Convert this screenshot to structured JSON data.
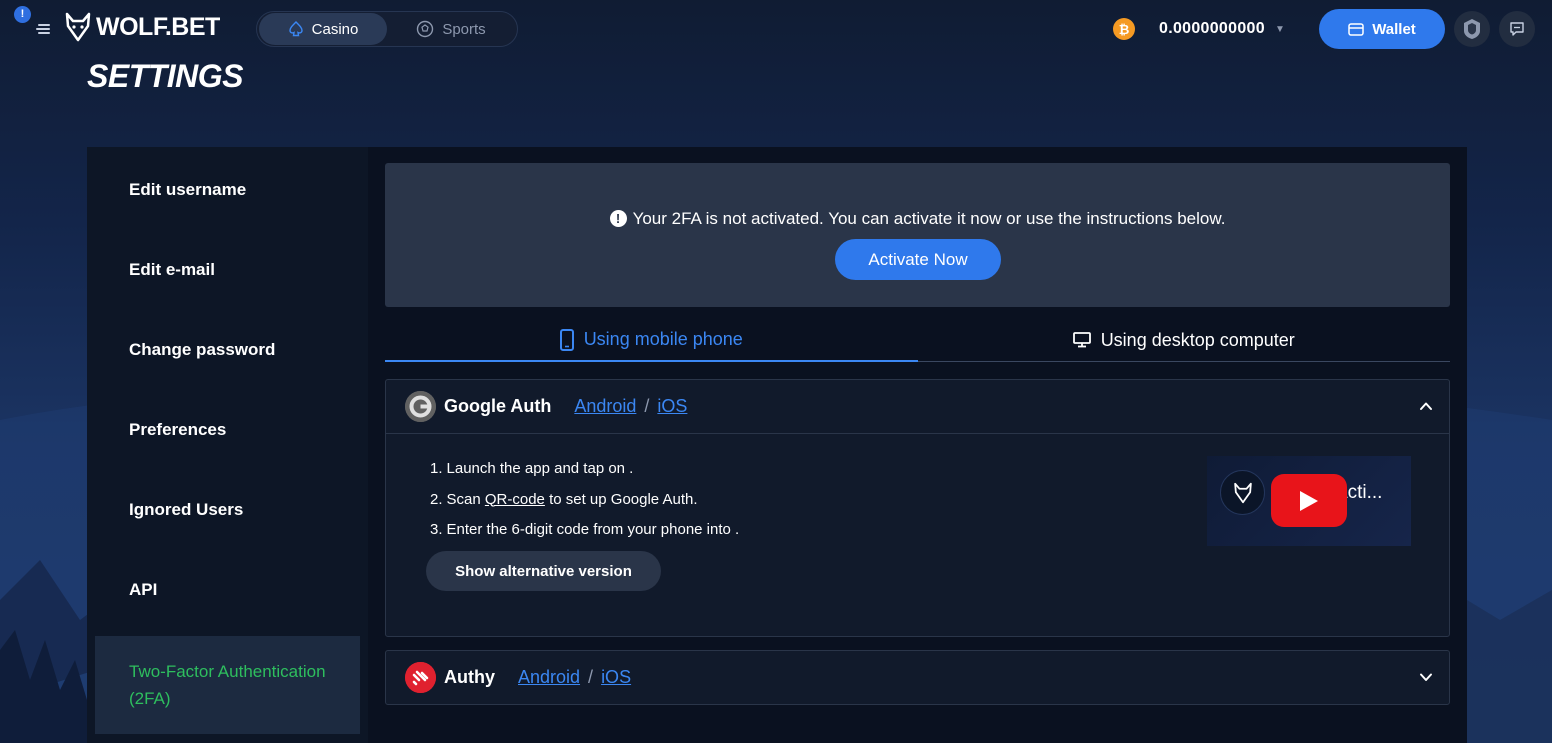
{
  "header": {
    "notification_count": "!",
    "logo_text": "WOLF.BET",
    "modes": [
      {
        "label": "Casino",
        "active": true
      },
      {
        "label": "Sports",
        "active": false
      }
    ],
    "balance": "0.0000000000",
    "currency_icon": "bitcoin-icon",
    "wallet_label": "Wallet"
  },
  "page": {
    "title": "SETTINGS"
  },
  "sidebar": {
    "items": [
      {
        "label": "Edit username"
      },
      {
        "label": "Edit e-mail"
      },
      {
        "label": "Change password"
      },
      {
        "label": "Preferences"
      },
      {
        "label": "Ignored Users"
      },
      {
        "label": "API"
      },
      {
        "label": "Two-Factor Authentication (2FA)",
        "active": true
      }
    ]
  },
  "main": {
    "alert_text": "Your 2FA is not activated. You can activate it now or use the instructions below.",
    "activate_label": "Activate Now",
    "tabs": [
      {
        "label": "Using mobile phone",
        "active": true
      },
      {
        "label": "Using desktop computer",
        "active": false
      }
    ],
    "google_auth": {
      "title": "Google Auth",
      "android": "Android",
      "separator": "/",
      "ios": "iOS",
      "steps": {
        "s1_num": "1.",
        "s1": "Launch the app and tap on .",
        "s2_num": "2.",
        "s2_pre": "Scan ",
        "s2_link": "QR-code",
        "s2_post": " to set up Google Auth.",
        "s3_num": "3.",
        "s3": "Enter the 6-digit code from your phone into ."
      },
      "alt_button": "Show alternative version",
      "video_title": "acti..."
    },
    "authy": {
      "title": "Authy",
      "android": "Android",
      "separator": "/",
      "ios": "iOS"
    }
  },
  "colors": {
    "accent": "#2f79ec",
    "link": "#3b87f3",
    "active_sidebar": "#2ebe5e",
    "bitcoin": "#f59a23",
    "youtube": "#e8141a"
  }
}
